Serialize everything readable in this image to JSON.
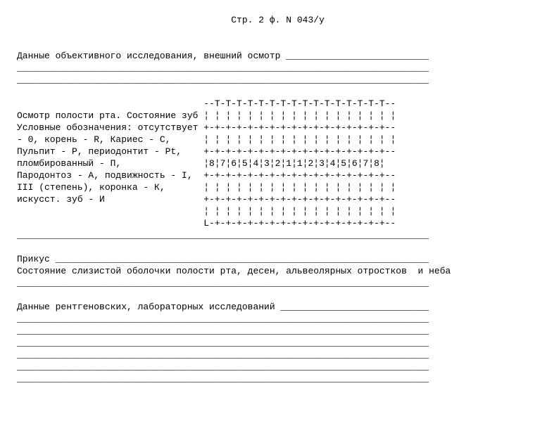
{
  "header": "                                       Стр. 2 ф. N 043/у",
  "section1": {
    "title": "Данные объективного исследования, внешний осмотр __________________________",
    "blank_lines": [
      "___________________________________________________________________________",
      "___________________________________________________________________________"
    ]
  },
  "chart": {
    "top_border": "                                  --T-T-T-T-T-T-T-T-T-T-T-T-T-T-T-T--",
    "row_blank": "                                  ¦ ¦ ¦ ¦ ¦ ¦ ¦ ¦ ¦ ¦ ¦ ¦ ¦ ¦ ¦ ¦ ¦ ¦",
    "row_sep": "                                  +-+-+-+-+-+-+-+-+-+-+-+-+-+-+-+-+--",
    "row_numbers": "                                  ¦8¦7¦6¦5¦4¦3¦2¦1¦1¦2¦3¦4¦5¦6¦7¦8¦  ",
    "bottom_border": "                                  L-+-+-+-+-+-+-+-+-+-+-+-+-+-+-+-+--"
  },
  "legend": {
    "l1": "Осмотр полости рта. Состояние зубов",
    "l2": "Условные обозначения: отсутствует -",
    "l3": "- 0, корень - R, Кариес - С,",
    "l4": "Пульпит - Р, периодонтит - Pt,",
    "l5": "пломбированный - П,",
    "l6": "Пародонтоз - А, подвижность - I, II",
    "l7": "III (степень), коронка - К,",
    "l8": "искусст. зуб - И"
  },
  "hr": "___________________________________________________________________________",
  "section2": {
    "title": "Прикус ____________________________________________________________________",
    "subtitle": "Состояние слизистой оболочки полости рта, десен, альвеолярных отростков  и неба",
    "blank_lines": [
      "___________________________________________________________________________"
    ]
  },
  "section3": {
    "title": "Данные рентгеновских, лабораторных исследований ___________________________",
    "blank_lines": [
      "___________________________________________________________________________",
      "___________________________________________________________________________",
      "___________________________________________________________________________",
      "___________________________________________________________________________",
      "___________________________________________________________________________",
      "___________________________________________________________________________"
    ]
  },
  "composed_lines": [
    "                                       Стр. 2 ф. N 043/у",
    "",
    "",
    "Данные объективного исследования, внешний осмотр __________________________",
    "___________________________________________________________________________",
    "___________________________________________________________________________",
    "",
    "                                  --T-T-T-T-T-T-T-T-T-T-T-T-T-T-T-T--",
    "Осмотр полости рта. Состояние зуб ¦ ¦ ¦ ¦ ¦ ¦ ¦ ¦ ¦ ¦ ¦ ¦ ¦ ¦ ¦ ¦ ¦ ¦",
    "Условные обозначения: отсутствует +-+-+-+-+-+-+-+-+-+-+-+-+-+-+-+-+--",
    "- 0, корень - R, Кариес - С,      ¦ ¦ ¦ ¦ ¦ ¦ ¦ ¦ ¦ ¦ ¦ ¦ ¦ ¦ ¦ ¦ ¦ ¦",
    "Пульпит - Р, периодонтит - Pt,    +-+-+-+-+-+-+-+-+-+-+-+-+-+-+-+-+--",
    "пломбированный - П,               ¦8¦7¦6¦5¦4¦3¦2¦1¦1¦2¦3¦4¦5¦6¦7¦8¦  ",
    "Пародонтоз - А, подвижность - I,  +-+-+-+-+-+-+-+-+-+-+-+-+-+-+-+-+--",
    "III (степень), коронка - К,       ¦ ¦ ¦ ¦ ¦ ¦ ¦ ¦ ¦ ¦ ¦ ¦ ¦ ¦ ¦ ¦ ¦ ¦",
    "искусст. зуб - И                  +-+-+-+-+-+-+-+-+-+-+-+-+-+-+-+-+--",
    "                                  ¦ ¦ ¦ ¦ ¦ ¦ ¦ ¦ ¦ ¦ ¦ ¦ ¦ ¦ ¦ ¦ ¦ ¦",
    "                                  L-+-+-+-+-+-+-+-+-+-+-+-+-+-+-+-+--",
    "___________________________________________________________________________",
    "",
    "Прикус ____________________________________________________________________",
    "Состояние слизистой оболочки полости рта, десен, альвеолярных отростков  и неба",
    "___________________________________________________________________________",
    "",
    "Данные рентгеновских, лабораторных исследований ___________________________",
    "___________________________________________________________________________",
    "___________________________________________________________________________",
    "___________________________________________________________________________",
    "___________________________________________________________________________",
    "___________________________________________________________________________",
    "___________________________________________________________________________"
  ]
}
